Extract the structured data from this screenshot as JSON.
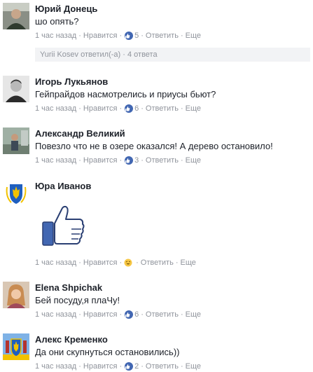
{
  "meta_labels": {
    "like": "Нравится",
    "reply": "Ответить",
    "more": "Еще",
    "dot": "·"
  },
  "comments": [
    {
      "name": "Юрий Донець",
      "text": "шо опять?",
      "time": "1 час назад",
      "reaction": "like",
      "reaction_count": "5",
      "avatar_icon": "user-photo-icon"
    },
    {
      "name": "Игорь Лукьянов",
      "text": "Гейпрайдов насмотрелись и приусы бьют?",
      "time": "1 час назад",
      "reaction": "like",
      "reaction_count": "6",
      "avatar_icon": "user-photo-icon"
    },
    {
      "name": "Александр Великий",
      "text": "Повезло что не в озере оказался! А дерево остановило!",
      "time": "1 час назад",
      "reaction": "like",
      "reaction_count": "3",
      "avatar_icon": "user-photo-icon"
    },
    {
      "name": "Юра Иванов",
      "text": "",
      "sticker": "thumbs-up-sticker-icon",
      "time": "1 час назад",
      "reaction": "haha",
      "reaction_count": "",
      "avatar_icon": "coat-of-arms-icon"
    },
    {
      "name": "Elena Shpichak",
      "text": "Бей посуду,я плаЧу!",
      "time": "1 час назад",
      "reaction": "like",
      "reaction_count": "6",
      "avatar_icon": "user-photo-icon"
    },
    {
      "name": "Алекс Кременко",
      "text": "Да они скупнуться остановились))",
      "time": "1 час назад",
      "reaction": "like",
      "reaction_count": "2",
      "avatar_icon": "coat-of-arms-icon"
    }
  ],
  "replies_bar": {
    "author": "Yurii Kosev",
    "action": "ответил(-а)",
    "count_label": "4 ответа"
  },
  "colors": {
    "link_blue": "#4267b2",
    "meta_gray": "#90949c",
    "reply_bg": "#f2f3f5",
    "text": "#1d2129"
  }
}
